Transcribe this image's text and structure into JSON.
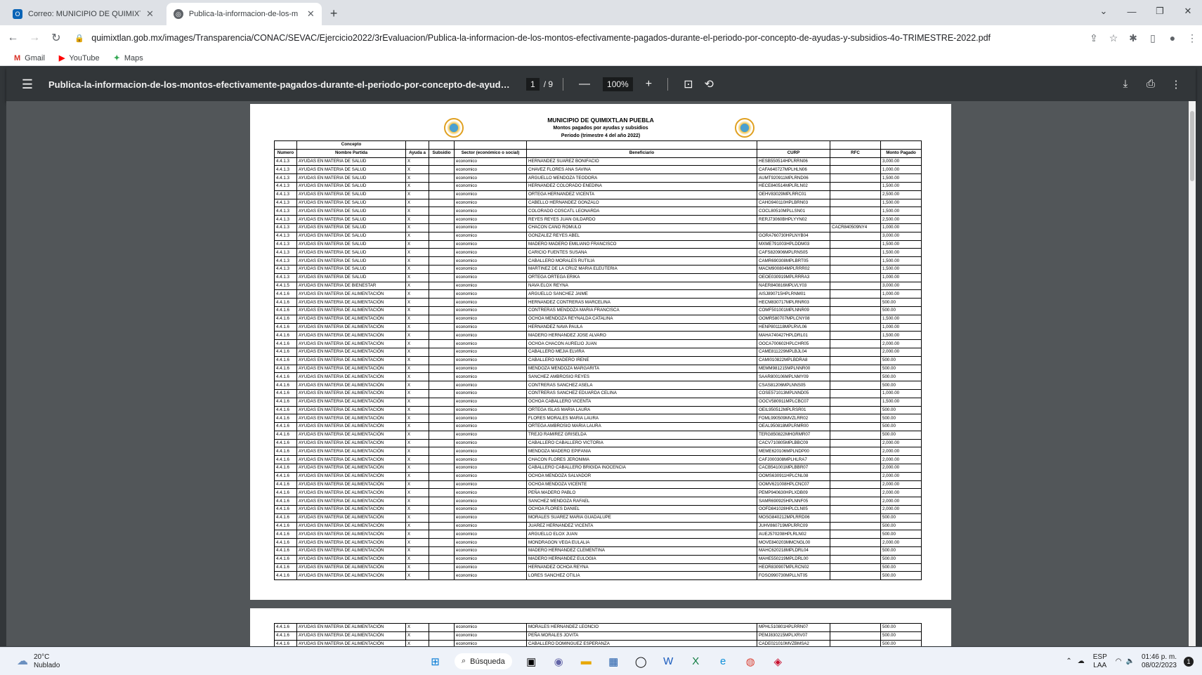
{
  "tabs": [
    {
      "label": "Correo: MUNICIPIO DE QUIMIXTL",
      "icon": "outlook-icon"
    },
    {
      "label": "Publica-la-informacion-de-los-m",
      "icon": "globe-icon"
    }
  ],
  "url": "quimixtlan.gob.mx/images/Transparencia/CONAC/SEVAC/Ejercicio2022/3rEvaluacion/Publica-la-informacion-de-los-montos-efectivamente-pagados-durante-el-periodo-por-concepto-de-ayudas-y-subsidios-4o-TRIMESTRE-2022.pdf",
  "bookmarks": [
    {
      "label": "Gmail",
      "icon": "gmail-icon"
    },
    {
      "label": "YouTube",
      "icon": "youtube-icon"
    },
    {
      "label": "Maps",
      "icon": "maps-icon"
    }
  ],
  "pdf": {
    "title": "Publica-la-informacion-de-los-montos-efectivamente-pagados-durante-el-periodo-por-concepto-de-ayudas-y-subsi...",
    "page": "1",
    "pages": "/ 9",
    "zoom": "100%"
  },
  "doc": {
    "org": "MUNICIPIO DE QUIMIXTLAN PUEBLA",
    "subtitle": "Montos pagados por ayudas y subsidios",
    "period": "Periodo (trimestre 4 del año 2022)"
  },
  "table_headers": {
    "concepto": "Concepto",
    "numero": "Numero",
    "partida": "Nombre Partida",
    "ayuda": "Ayuda a",
    "subsidio": "Subsidio",
    "sector": "Sector (económico o social)",
    "beneficiario": "Beneficiario",
    "curp": "CURP",
    "rfc": "RFC",
    "monto": "Monto Pagado"
  },
  "rows": [
    [
      "4.4.1.3",
      "AYUDAS EN MATERIA DE SALUD",
      "HERNANDEZ SUAREZ BONIFACIO",
      "HESB550514HPLRRN06",
      "",
      "3,000.00"
    ],
    [
      "4.4.1.3",
      "AYUDAS EN MATERIA DE SALUD",
      "CHAVEZ FLORES ANA SAVINA",
      "CAFA640727MPLHLN06",
      "",
      "1,000.00"
    ],
    [
      "4.4.1.3",
      "AYUDAS EN MATERIA DE SALUD",
      "ARGUELLO MENDOZA TEODORA",
      "AUMT920911MPLRND06",
      "",
      "1,500.00"
    ],
    [
      "4.4.1.3",
      "AYUDAS EN MATERIA DE SALUD",
      "HERNANDEZ COLORADO ENEDINA",
      "HECE840514MPLRLN02",
      "",
      "1,500.00"
    ],
    [
      "4.4.1.3",
      "AYUDAS EN MATERIA DE SALUD",
      "ORTEGA HERNANDEZ VICENTA",
      "OEHV83029MPLRRC01",
      "",
      "2,500.00"
    ],
    [
      "4.4.1.3",
      "AYUDAS EN MATERIA DE SALUD",
      "CABELLO HERNANDEZ GONZALO",
      "CAHG940110HPLBRN03",
      "",
      "1,500.00"
    ],
    [
      "4.4.1.3",
      "AYUDAS EN MATERIA DE SALUD",
      "COLORADO COSCATL LEONARDA",
      "COCL80510MPLLSN01",
      "",
      "1,500.00"
    ],
    [
      "4.4.1.3",
      "AYUDAS EN MATERIA DE SALUD",
      "REYES REYES JUAN GILDARDO",
      "RERJ73060BHPLYYN02",
      "",
      "2,500.00"
    ],
    [
      "4.4.1.3",
      "AYUDAS EN MATERIA DE SALUD",
      "CHACON CANO ROMULO",
      "",
      "CACR840509NY4",
      "1,000.00"
    ],
    [
      "4.4.1.3",
      "AYUDAS EN MATERIA DE SALUD",
      "GONZALEZ REYES ABEL",
      "GORA760730HPLNYB04",
      "",
      "3,000.00"
    ],
    [
      "4.4.1.3",
      "AYUDAS EN MATERIA DE SALUD",
      "MADERO MADERO EMILIANO FRANCISCO",
      "MXME791003HPLDDM03",
      "",
      "1,500.00"
    ],
    [
      "4.4.1.3",
      "AYUDAS EN MATERIA DE SALUD",
      "CARICIO FUENTES SUSANA",
      "CAFS820906MPLRNS05",
      "",
      "1,500.00"
    ],
    [
      "4.4.1.3",
      "AYUDAS EN MATERIA DE SALUD",
      "CABALLERO MORALES RUTILIA",
      "CAMR690308MPLBRT05",
      "",
      "1,500.00"
    ],
    [
      "4.4.1.3",
      "AYUDAS EN MATERIA DE SALUD",
      "MARTINEZ DE LA CRUZ MARIA ELEUTERIA",
      "MACM900804MPLRRR02",
      "",
      "1,500.00"
    ],
    [
      "4.4.1.3",
      "AYUDAS EN MATERIA DE SALUD",
      "ORTEGA ORTEGA ERIKA",
      "OEOE030919MPLRRRA3",
      "",
      "1,000.00"
    ],
    [
      "4.4.1.5",
      "AYUDAS EN MATERIA DE BIENESTAR",
      "NAVA ELOX REYNA",
      "NAER840816MPLVLY03",
      "",
      "3,000.00"
    ],
    [
      "4.4.1.6",
      "AYUDAS EN MATERIA DE ALIMENTACIÓN",
      "ARGUELLO SANCHEZ JAIME",
      "AISJ890715HPLRNM01",
      "",
      "1,000.00"
    ],
    [
      "4.4.1.6",
      "AYUDAS EN MATERIA DE ALIMENTACIÓN",
      "HERNANDEZ CONTRERAS MARCELINA",
      "HECM830717MPLRNR03",
      "",
      "500.00"
    ],
    [
      "4.4.1.6",
      "AYUDAS EN MATERIA DE ALIMENTACIÓN",
      "CONTRERAS MENDOZA MARIA FRANCISCA",
      "COMF501001MPLNNR09",
      "",
      "500.00"
    ],
    [
      "4.4.1.6",
      "AYUDAS EN MATERIA DE ALIMENTACIÓN",
      "OCHOA MENDOZA REYNALDA CATALINA",
      "OOMR580707MPLCNY08",
      "",
      "1,500.00"
    ],
    [
      "4.4.1.6",
      "AYUDAS EN MATERIA DE ALIMENTACIÓN",
      "HERNANDEZ NAVA PAULA",
      "HENP801118MPLRVL06",
      "",
      "1,000.00"
    ],
    [
      "4.4.1.6",
      "AYUDAS EN MATERIA DE ALIMENTACIÓN",
      "MADERO HERNANDEZ JOSE ALVARO",
      "MAHA740427HPLDRL01",
      "",
      "1,500.00"
    ],
    [
      "4.4.1.6",
      "AYUDAS EN MATERIA DE ALIMENTACIÓN",
      "OCHOA CHACON AURELIO JUAN",
      "OOCA700602HPLCHR05",
      "",
      "2,000.00"
    ],
    [
      "4.4.1.6",
      "AYUDAS EN MATERIA DE ALIMENTACIÓN",
      "CABALLERO MEJIA ELVIRA",
      "CAME811229MPLBJL04",
      "",
      "2,000.00"
    ],
    [
      "4.4.1.6",
      "AYUDAS EN MATERIA DE ALIMENTACIÓN",
      "CABALLERO MADERO IRENE",
      "CAMI010822MPLBDRA8",
      "",
      "500.00"
    ],
    [
      "4.4.1.6",
      "AYUDAS EN MATERIA DE ALIMENTACIÓN",
      "MENDOZA MENDOZA MARGARITA",
      "MEMM981215MPLNNR00",
      "",
      "500.00"
    ],
    [
      "4.4.1.6",
      "AYUDAS EN MATERIA DE ALIMENTACIÓN",
      "SANCHEZ AMBROSIO REYES",
      "SAAR800106MPLNMY09",
      "",
      "500.00"
    ],
    [
      "4.4.1.6",
      "AYUDAS EN MATERIA DE ALIMENTACIÓN",
      "CONTRERAS SANCHEZ ASELA",
      "CSAS81206MPLNNS05",
      "",
      "500.00"
    ],
    [
      "4.4.1.6",
      "AYUDAS EN MATERIA DE ALIMENTACIÓN",
      "CONTRERAS SANCHEZ EDUARDA CELINA",
      "COSE571013MPLNND05",
      "",
      "1,000.00"
    ],
    [
      "4.4.1.6",
      "AYUDAS EN MATERIA DE ALIMENTACIÓN",
      "OCHOA CABALLERO VICENTA",
      "OOCV580911MPLCBC07",
      "",
      "1,500.00"
    ],
    [
      "4.4.1.6",
      "AYUDAS EN MATERIA DE ALIMENTACIÓN",
      "ORTEGA ISLAS MARIA LAURA",
      "OEIL950512MPLRSR01",
      "",
      "500.00"
    ],
    [
      "4.4.1.6",
      "AYUDAS EN MATERIA DE ALIMENTACIÓN",
      "FLORES MORALES MARIA LAURA",
      "FOML990509MVZLRR02",
      "",
      "500.00"
    ],
    [
      "4.4.1.6",
      "AYUDAS EN MATERIA DE ALIMENTACIÓN",
      "ORTEGA AMBROSIO MARIA LAURA",
      "OEAL950818MPLRMR00",
      "",
      "500.00"
    ],
    [
      "4.4.1.6",
      "AYUDAS EN MATERIA DE ALIMENTACIÓN",
      "TREJO RAMIREZ GRISELDA",
      "TERG850822MHGRMR07",
      "",
      "500.00"
    ],
    [
      "4.4.1.6",
      "AYUDAS EN MATERIA DE ALIMENTACIÓN",
      "CABALLERO CABALLERO VICTORIA",
      "CACV710805MPLBBC09",
      "",
      "2,000.00"
    ],
    [
      "4.4.1.6",
      "AYUDAS EN MATERIA DE ALIMENTACIÓN",
      "MENDOZA MADERO EPIFANIA",
      "MEME620106MPLNDP00",
      "",
      "2,000.00"
    ],
    [
      "4.4.1.6",
      "AYUDAS EN MATERIA DE ALIMENTACIÓN",
      "CHACON FLORES JERONIMA",
      "CAFJ000308MPLHLRA7",
      "",
      "2,000.00"
    ],
    [
      "4.4.1.6",
      "AYUDAS EN MATERIA DE ALIMENTACIÓN",
      "CABALLERO CABALLERO BRIGIDA INOCENCIA",
      "CACB541001MPLBBR07",
      "",
      "2,000.00"
    ],
    [
      "4.4.1.6",
      "AYUDAS EN MATERIA DE ALIMENTACIÓN",
      "OCHOA MENDOZA SALVADOR",
      "OOMS630911HPLCNL08",
      "",
      "2,000.00"
    ],
    [
      "4.4.1.6",
      "AYUDAS EN MATERIA DE ALIMENTACIÓN",
      "OCHOA MENDOZA VICENTE",
      "OOMV621008HPLCNC07",
      "",
      "2,000.00"
    ],
    [
      "4.4.1.6",
      "AYUDAS EN MATERIA DE ALIMENTACIÓN",
      "PEÑA MADERO PABLO",
      "PEMP940630HPLXDB09",
      "",
      "2,000.00"
    ],
    [
      "4.4.1.6",
      "AYUDAS EN MATERIA DE ALIMENTACIÓN",
      "SANCHEZ MENDOZA RAFAEL",
      "SAMR690925HPLNNF05",
      "",
      "2,000.00"
    ],
    [
      "4.4.1.6",
      "AYUDAS EN MATERIA DE ALIMENTACIÓN",
      "OCHOA FLORES DANIEL",
      "OOFD841028HPLCLN05",
      "",
      "2,000.00"
    ],
    [
      "4.4.1.6",
      "AYUDAS EN MATERIA DE ALIMENTACIÓN",
      "MORALES SUAREZ MARIA GUADALUPE",
      "MOSG840212MPLRRD06",
      "",
      "500.00"
    ],
    [
      "4.4.1.6",
      "AYUDAS EN MATERIA DE ALIMENTACIÓN",
      "JUAREZ HERNANDEZ VICENTA",
      "JUHV860719MPLRRC09",
      "",
      "500.00"
    ],
    [
      "4.4.1.6",
      "AYUDAS EN MATERIA DE ALIMENTACIÓN",
      "ARGUELLO ELOX JUAN",
      "AUEJ570208HPLRLN02",
      "",
      "500.00"
    ],
    [
      "4.4.1.6",
      "AYUDAS EN MATERIA DE ALIMENTACIÓN",
      "MONDRAGON VEGA EULALIA",
      "MOVE840203MMCNGL00",
      "",
      "2,000.00"
    ],
    [
      "4.4.1.6",
      "AYUDAS EN MATERIA DE ALIMENTACIÓN",
      "MADERO HERNANDEZ CLEMENTINA",
      "MAHC620218MPLDRL04",
      "",
      "500.00"
    ],
    [
      "4.4.1.6",
      "AYUDAS EN MATERIA DE ALIMENTACIÓN",
      "MADERO HERNANDEZ EULOGIA",
      "MAHE550219MPLDRL00",
      "",
      "500.00"
    ],
    [
      "4.4.1.6",
      "AYUDAS EN MATERIA DE ALIMENTACIÓN",
      "HERNANDEZ OCHOA REYNA",
      "HEOR830907MPLRCN02",
      "",
      "500.00"
    ],
    [
      "4.4.1.6",
      "AYUDAS EN MATERIA DE ALIMENTACIÓN",
      "LORES SANCHEZ OTILIA",
      "FOSO990730MPLLNT05",
      "",
      "500.00"
    ]
  ],
  "rows_page2": [
    [
      "4.4.1.6",
      "AYUDAS EN MATERIA DE ALIMENTACIÓN",
      "MORALES HERNANDEZ LEONCIO",
      "MPHL510801HPLRRN07",
      "",
      "500.00"
    ],
    [
      "4.4.1.6",
      "AYUDAS EN MATERIA DE ALIMENTACIÓN",
      "PEÑA MORALES JOVITA",
      "PEMJ830215MPLXRV07",
      "",
      "500.00"
    ],
    [
      "4.4.1.6",
      "AYUDAS EN MATERIA DE ALIMENTACIÓN",
      "CABALLERO DOMINGUEZ ESPERANZA",
      "CADE021010MVZBMSA2",
      "",
      "500.00"
    ]
  ],
  "ayuda_mark": "X",
  "sector_value": "economico",
  "taskbar": {
    "temp": "20°C",
    "weather": "Nublado",
    "search": "Búsqueda",
    "lang1": "ESP",
    "lang2": "LAA",
    "time": "01:46 p. m.",
    "date": "08/02/2023",
    "notif": "1"
  }
}
